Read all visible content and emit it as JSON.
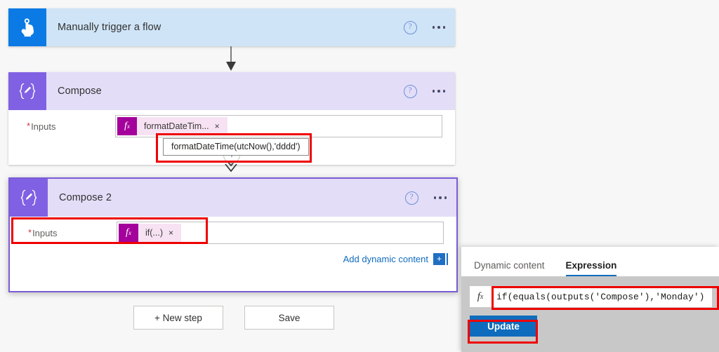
{
  "app": {
    "canvas_background": "#f7f7f7",
    "accent_blue": "#0f6cbd",
    "compose_purple": "#8061e3",
    "trigger_blue": "#0b7ae5",
    "annotation_red": "#ee0000"
  },
  "trigger_card": {
    "title": "Manually trigger a flow",
    "icon": "tap-hand-icon",
    "help_glyph": "?",
    "menu_glyph": "..."
  },
  "compose_card": {
    "title": "Compose",
    "icon": "compose-braces-pencil-icon",
    "help_glyph": "?",
    "menu_glyph": "...",
    "input_label": "Inputs",
    "required_marker": "*",
    "token": {
      "fx_label": "f",
      "fx_sub": "x",
      "text": "formatDateTim...",
      "remove_glyph": "×"
    }
  },
  "expression_tooltip": {
    "text": "formatDateTime(utcNow(),'dddd')"
  },
  "insert_button": {
    "glyph": "+"
  },
  "compose2_card": {
    "title": "Compose 2",
    "icon": "compose-braces-pencil-icon",
    "help_glyph": "?",
    "menu_glyph": "...",
    "input_label": "Inputs",
    "required_marker": "*",
    "token": {
      "fx_label": "f",
      "fx_sub": "x",
      "text": "if(...)",
      "remove_glyph": "×"
    },
    "add_dynamic_content": {
      "link_label": "Add dynamic content",
      "button_glyph": "+"
    }
  },
  "flow_buttons": {
    "new_step": "+ New step",
    "save": "Save"
  },
  "expression_panel": {
    "tabs": [
      {
        "label": "Dynamic content",
        "active": false
      },
      {
        "label": "Expression",
        "active": true
      }
    ],
    "fx_label": "f",
    "fx_sub": "x",
    "expression_value": "if(equals(outputs('Compose'),'Monday')",
    "expression_placeholder": "",
    "update_label": "Update"
  }
}
